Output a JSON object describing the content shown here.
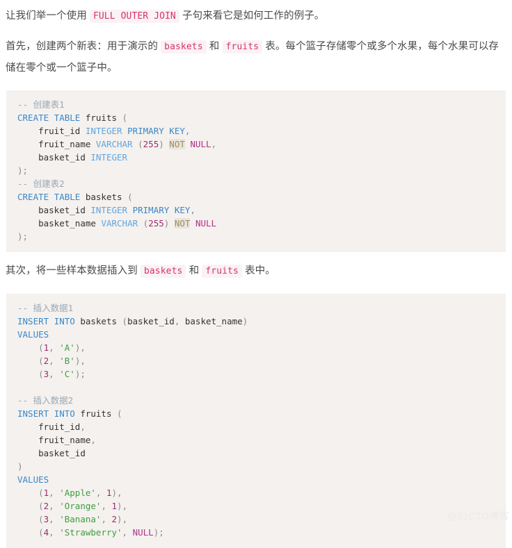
{
  "article": {
    "paragraph_1": {
      "before": "让我们举一个使用",
      "code": "FULL OUTER JOIN",
      "after": "子句来看它是如何工作的例子。"
    },
    "paragraph_2": {
      "seg1": "首先，创建两个新表：用于演示的",
      "code1": "baskets",
      "seg2": "和",
      "code2": "fruits",
      "seg3": "表。每个篮子存储零个或多个水果，每个水果可以存储在零个或一个篮子中。"
    },
    "paragraph_3": {
      "seg1": "其次，将一些样本数据插入到",
      "code1": "baskets",
      "seg2": "和",
      "code2": "fruits",
      "seg3": "表中。"
    }
  },
  "code_block_1": {
    "language": "sql",
    "lines": [
      {
        "tokens": [
          {
            "t": "-- 创建表1",
            "c": "tok-comment"
          }
        ]
      },
      {
        "tokens": [
          {
            "t": "CREATE",
            "c": "tok-kw"
          },
          {
            "t": " ",
            "c": ""
          },
          {
            "t": "TABLE",
            "c": "tok-kw"
          },
          {
            "t": " ",
            "c": ""
          },
          {
            "t": "fruits",
            "c": "tok-name"
          },
          {
            "t": " ",
            "c": ""
          },
          {
            "t": "(",
            "c": "tok-punc"
          }
        ]
      },
      {
        "tokens": [
          {
            "t": "    ",
            "c": ""
          },
          {
            "t": "fruit_id",
            "c": "tok-name"
          },
          {
            "t": " ",
            "c": ""
          },
          {
            "t": "INTEGER",
            "c": "tok-type"
          },
          {
            "t": " ",
            "c": ""
          },
          {
            "t": "PRIMARY",
            "c": "tok-attr"
          },
          {
            "t": " ",
            "c": ""
          },
          {
            "t": "KEY",
            "c": "tok-attr"
          },
          {
            "t": ",",
            "c": "tok-punc"
          }
        ]
      },
      {
        "tokens": [
          {
            "t": "    ",
            "c": ""
          },
          {
            "t": "fruit_name",
            "c": "tok-name"
          },
          {
            "t": " ",
            "c": ""
          },
          {
            "t": "VARCHAR",
            "c": "tok-type"
          },
          {
            "t": " ",
            "c": ""
          },
          {
            "t": "(",
            "c": "tok-punc"
          },
          {
            "t": "255",
            "c": "tok-num"
          },
          {
            "t": ")",
            "c": "tok-punc"
          },
          {
            "t": " ",
            "c": ""
          },
          {
            "t": "NOT",
            "c": "tok-not"
          },
          {
            "t": " ",
            "c": ""
          },
          {
            "t": "NULL",
            "c": "tok-null"
          },
          {
            "t": ",",
            "c": "tok-punc"
          }
        ]
      },
      {
        "tokens": [
          {
            "t": "    ",
            "c": ""
          },
          {
            "t": "basket_id",
            "c": "tok-name"
          },
          {
            "t": " ",
            "c": ""
          },
          {
            "t": "INTEGER",
            "c": "tok-type"
          }
        ]
      },
      {
        "tokens": [
          {
            "t": ");",
            "c": "tok-punc"
          }
        ]
      },
      {
        "tokens": [
          {
            "t": "-- 创建表2",
            "c": "tok-comment"
          }
        ]
      },
      {
        "tokens": [
          {
            "t": "CREATE",
            "c": "tok-kw"
          },
          {
            "t": " ",
            "c": ""
          },
          {
            "t": "TABLE",
            "c": "tok-kw"
          },
          {
            "t": " ",
            "c": ""
          },
          {
            "t": "baskets",
            "c": "tok-name"
          },
          {
            "t": " ",
            "c": ""
          },
          {
            "t": "(",
            "c": "tok-punc"
          }
        ]
      },
      {
        "tokens": [
          {
            "t": "    ",
            "c": ""
          },
          {
            "t": "basket_id",
            "c": "tok-name"
          },
          {
            "t": " ",
            "c": ""
          },
          {
            "t": "INTEGER",
            "c": "tok-type"
          },
          {
            "t": " ",
            "c": ""
          },
          {
            "t": "PRIMARY",
            "c": "tok-attr"
          },
          {
            "t": " ",
            "c": ""
          },
          {
            "t": "KEY",
            "c": "tok-attr"
          },
          {
            "t": ",",
            "c": "tok-punc"
          }
        ]
      },
      {
        "tokens": [
          {
            "t": "    ",
            "c": ""
          },
          {
            "t": "basket_name",
            "c": "tok-name"
          },
          {
            "t": " ",
            "c": ""
          },
          {
            "t": "VARCHAR",
            "c": "tok-type"
          },
          {
            "t": " ",
            "c": ""
          },
          {
            "t": "(",
            "c": "tok-punc"
          },
          {
            "t": "255",
            "c": "tok-num"
          },
          {
            "t": ")",
            "c": "tok-punc"
          },
          {
            "t": " ",
            "c": ""
          },
          {
            "t": "NOT",
            "c": "tok-not"
          },
          {
            "t": " ",
            "c": ""
          },
          {
            "t": "NULL",
            "c": "tok-null"
          }
        ]
      },
      {
        "tokens": [
          {
            "t": ");",
            "c": "tok-punc"
          }
        ]
      }
    ]
  },
  "code_block_2": {
    "language": "sql",
    "lines": [
      {
        "tokens": [
          {
            "t": "-- 插入数据1",
            "c": "tok-comment"
          }
        ]
      },
      {
        "tokens": [
          {
            "t": "INSERT",
            "c": "tok-kw"
          },
          {
            "t": " ",
            "c": ""
          },
          {
            "t": "INTO",
            "c": "tok-kw"
          },
          {
            "t": " ",
            "c": ""
          },
          {
            "t": "baskets",
            "c": "tok-name"
          },
          {
            "t": " ",
            "c": ""
          },
          {
            "t": "(",
            "c": "tok-punc"
          },
          {
            "t": "basket_id",
            "c": "tok-name"
          },
          {
            "t": ", ",
            "c": "tok-punc"
          },
          {
            "t": "basket_name",
            "c": "tok-name"
          },
          {
            "t": ")",
            "c": "tok-punc"
          }
        ]
      },
      {
        "tokens": [
          {
            "t": "VALUES",
            "c": "tok-kw"
          }
        ]
      },
      {
        "tokens": [
          {
            "t": "    ",
            "c": ""
          },
          {
            "t": "(",
            "c": "tok-punc"
          },
          {
            "t": "1",
            "c": "tok-num"
          },
          {
            "t": ", ",
            "c": "tok-punc"
          },
          {
            "t": "'A'",
            "c": "tok-str"
          },
          {
            "t": "),",
            "c": "tok-punc"
          }
        ]
      },
      {
        "tokens": [
          {
            "t": "    ",
            "c": ""
          },
          {
            "t": "(",
            "c": "tok-punc"
          },
          {
            "t": "2",
            "c": "tok-num"
          },
          {
            "t": ", ",
            "c": "tok-punc"
          },
          {
            "t": "'B'",
            "c": "tok-str"
          },
          {
            "t": "),",
            "c": "tok-punc"
          }
        ]
      },
      {
        "tokens": [
          {
            "t": "    ",
            "c": ""
          },
          {
            "t": "(",
            "c": "tok-punc"
          },
          {
            "t": "3",
            "c": "tok-num"
          },
          {
            "t": ", ",
            "c": "tok-punc"
          },
          {
            "t": "'C'",
            "c": "tok-str"
          },
          {
            "t": ");",
            "c": "tok-punc"
          }
        ]
      },
      {
        "tokens": [
          {
            "t": "",
            "c": ""
          }
        ]
      },
      {
        "tokens": [
          {
            "t": "-- 插入数据2",
            "c": "tok-comment"
          }
        ]
      },
      {
        "tokens": [
          {
            "t": "INSERT",
            "c": "tok-kw"
          },
          {
            "t": " ",
            "c": ""
          },
          {
            "t": "INTO",
            "c": "tok-kw"
          },
          {
            "t": " ",
            "c": ""
          },
          {
            "t": "fruits",
            "c": "tok-name"
          },
          {
            "t": " ",
            "c": ""
          },
          {
            "t": "(",
            "c": "tok-punc"
          }
        ]
      },
      {
        "tokens": [
          {
            "t": "    ",
            "c": ""
          },
          {
            "t": "fruit_id",
            "c": "tok-name"
          },
          {
            "t": ",",
            "c": "tok-punc"
          }
        ]
      },
      {
        "tokens": [
          {
            "t": "    ",
            "c": ""
          },
          {
            "t": "fruit_name",
            "c": "tok-name"
          },
          {
            "t": ",",
            "c": "tok-punc"
          }
        ]
      },
      {
        "tokens": [
          {
            "t": "    ",
            "c": ""
          },
          {
            "t": "basket_id",
            "c": "tok-name"
          }
        ]
      },
      {
        "tokens": [
          {
            "t": ")",
            "c": "tok-punc"
          }
        ]
      },
      {
        "tokens": [
          {
            "t": "VALUES",
            "c": "tok-kw"
          }
        ]
      },
      {
        "tokens": [
          {
            "t": "    ",
            "c": ""
          },
          {
            "t": "(",
            "c": "tok-punc"
          },
          {
            "t": "1",
            "c": "tok-num"
          },
          {
            "t": ", ",
            "c": "tok-punc"
          },
          {
            "t": "'Apple'",
            "c": "tok-str"
          },
          {
            "t": ", ",
            "c": "tok-punc"
          },
          {
            "t": "1",
            "c": "tok-num"
          },
          {
            "t": "),",
            "c": "tok-punc"
          }
        ]
      },
      {
        "tokens": [
          {
            "t": "    ",
            "c": ""
          },
          {
            "t": "(",
            "c": "tok-punc"
          },
          {
            "t": "2",
            "c": "tok-num"
          },
          {
            "t": ", ",
            "c": "tok-punc"
          },
          {
            "t": "'Orange'",
            "c": "tok-str"
          },
          {
            "t": ", ",
            "c": "tok-punc"
          },
          {
            "t": "1",
            "c": "tok-num"
          },
          {
            "t": "),",
            "c": "tok-punc"
          }
        ]
      },
      {
        "tokens": [
          {
            "t": "    ",
            "c": ""
          },
          {
            "t": "(",
            "c": "tok-punc"
          },
          {
            "t": "3",
            "c": "tok-num"
          },
          {
            "t": ", ",
            "c": "tok-punc"
          },
          {
            "t": "'Banana'",
            "c": "tok-str"
          },
          {
            "t": ", ",
            "c": "tok-punc"
          },
          {
            "t": "2",
            "c": "tok-num"
          },
          {
            "t": "),",
            "c": "tok-punc"
          }
        ]
      },
      {
        "tokens": [
          {
            "t": "    ",
            "c": ""
          },
          {
            "t": "(",
            "c": "tok-punc"
          },
          {
            "t": "4",
            "c": "tok-num"
          },
          {
            "t": ", ",
            "c": "tok-punc"
          },
          {
            "t": "'Strawberry'",
            "c": "tok-str"
          },
          {
            "t": ", ",
            "c": "tok-punc"
          },
          {
            "t": "NULL",
            "c": "tok-null"
          },
          {
            "t": ");",
            "c": "tok-punc"
          }
        ]
      }
    ]
  },
  "watermark": {
    "url": "https://blog.csdn.net/wei",
    "brand": "@51CTO博客"
  },
  "colors": {
    "code_background": "#f4f1ee",
    "inline_code_text": "#d6336c",
    "inline_code_background": "#fbf2f4",
    "keyword": "#3a87c9",
    "type": "#60a5e0",
    "string": "#3f9e3f",
    "number": "#9c2c6e",
    "null": "#b2308a",
    "comment": "#9aa7b3",
    "body_text": "#4a4a4a"
  }
}
